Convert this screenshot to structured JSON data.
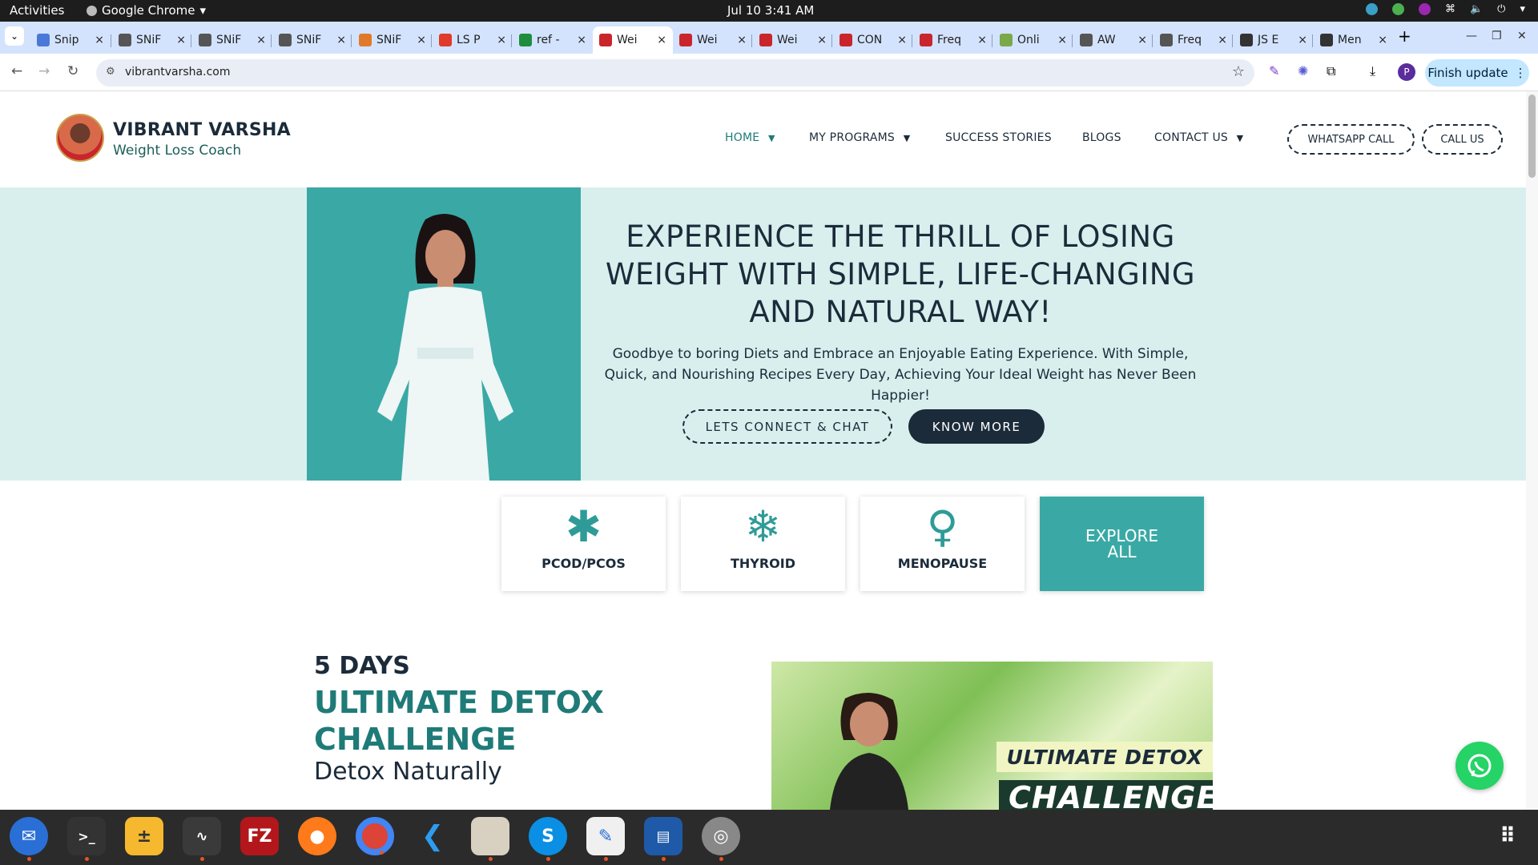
{
  "topbar": {
    "activities": "Activities",
    "app_name": "Google Chrome",
    "clock": "Jul 10  3:41 AM"
  },
  "tabs": [
    {
      "title": "Snip",
      "color": "#4a78d8"
    },
    {
      "title": "SNiF",
      "color": "#555555"
    },
    {
      "title": "SNiF",
      "color": "#555555"
    },
    {
      "title": "SNiF",
      "color": "#555555"
    },
    {
      "title": "SNiF",
      "color": "#e07a2a"
    },
    {
      "title": "LS P",
      "color": "#e03a2a"
    },
    {
      "title": "ref -",
      "color": "#1e8e3e"
    },
    {
      "title": "Wei",
      "color": "#c9252c"
    },
    {
      "title": "Wei",
      "color": "#c9252c"
    },
    {
      "title": "Wei",
      "color": "#c9252c"
    },
    {
      "title": "CON",
      "color": "#c9252c"
    },
    {
      "title": "Freq",
      "color": "#c9252c"
    },
    {
      "title": "Onli",
      "color": "#7aa84a"
    },
    {
      "title": "AW",
      "color": "#555555"
    },
    {
      "title": "Freq",
      "color": "#555555"
    },
    {
      "title": "JS E",
      "color": "#333333"
    },
    {
      "title": "Men",
      "color": "#333333"
    }
  ],
  "browser": {
    "url": "vibrantvarsha.com",
    "finish_update": "Finish update",
    "profile_initial": "P"
  },
  "site": {
    "brand": "VIBRANT VARSHA",
    "tagline": "Weight Loss Coach",
    "nav": [
      {
        "label": "HOME",
        "dropdown": true
      },
      {
        "label": "MY PROGRAMS",
        "dropdown": true
      },
      {
        "label": "SUCCESS STORIES",
        "dropdown": false
      },
      {
        "label": "BLOGS",
        "dropdown": false
      },
      {
        "label": "CONTACT US",
        "dropdown": true
      }
    ],
    "whatsapp_call": "WHATSAPP CALL",
    "call_us": "CALL US",
    "accent": "#3aa9a5",
    "dark": "#1b2b3a"
  },
  "hero": {
    "title": "EXPERIENCE THE THRILL OF LOSING WEIGHT WITH SIMPLE, LIFE-CHANGING AND NATURAL WAY!",
    "subtitle": "Goodbye to boring Diets and Embrace an Enjoyable Eating Experience. With Simple, Quick, and Nourishing Recipes Every Day, Achieving Your Ideal Weight has Never Been Happier!",
    "btn_connect": "LETS CONNECT & CHAT",
    "btn_know": "KNOW MORE"
  },
  "programs": [
    {
      "label": "PCOD/PCOS",
      "icon": "asterisk-icon"
    },
    {
      "label": "THYROID",
      "icon": "snowflake-icon"
    },
    {
      "label": "MENOPAUSE",
      "icon": "venus-icon"
    }
  ],
  "explore_all": "EXPLORE ALL",
  "detox": {
    "days": "5 DAYS",
    "title": "ULTIMATE DETOX CHALLENGE",
    "subtitle": "Detox Naturally",
    "banner_line1": "ULTIMATE DETOX",
    "banner_line2": "CHALLENGE"
  }
}
